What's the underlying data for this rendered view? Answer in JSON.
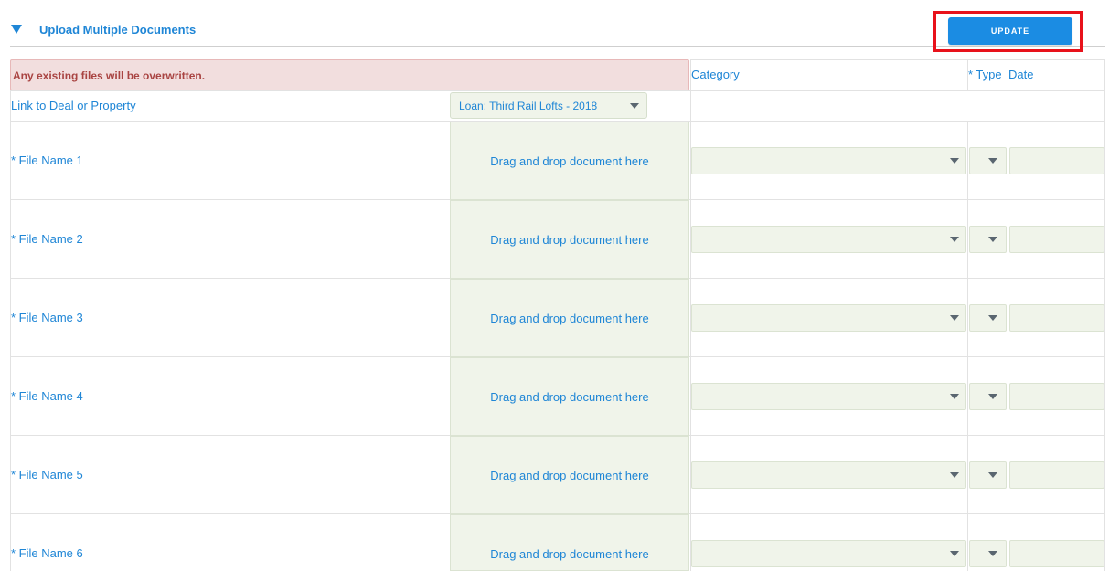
{
  "section": {
    "title": "Upload Multiple Documents",
    "update_label": "UPDATE"
  },
  "warning": {
    "text": "Any existing files will be overwritten."
  },
  "columns": {
    "category": "Category",
    "type": "* Type",
    "date": "Date"
  },
  "link": {
    "label": "Link to Deal or Property",
    "selected": "Loan: Third Rail Lofts - 2018"
  },
  "files": [
    {
      "label": "* File Name 1",
      "dropzone": "Drag and drop document here"
    },
    {
      "label": "* File Name 2",
      "dropzone": "Drag and drop document here"
    },
    {
      "label": "* File Name 3",
      "dropzone": "Drag and drop document here"
    },
    {
      "label": "* File Name 4",
      "dropzone": "Drag and drop document here"
    },
    {
      "label": "* File Name 5",
      "dropzone": "Drag and drop document here"
    },
    {
      "label": "* File Name 6",
      "dropzone": "Drag and drop document here"
    }
  ],
  "colors": {
    "accent": "#1f86d6",
    "button": "#1b8ce3",
    "highlight": "#e8121b",
    "warning_bg": "#f2dede",
    "warning_text": "#a94442",
    "field_bg": "#f0f4ea"
  },
  "icons": {
    "toggle": "caret-down-icon",
    "select": "chevron-down-icon"
  }
}
